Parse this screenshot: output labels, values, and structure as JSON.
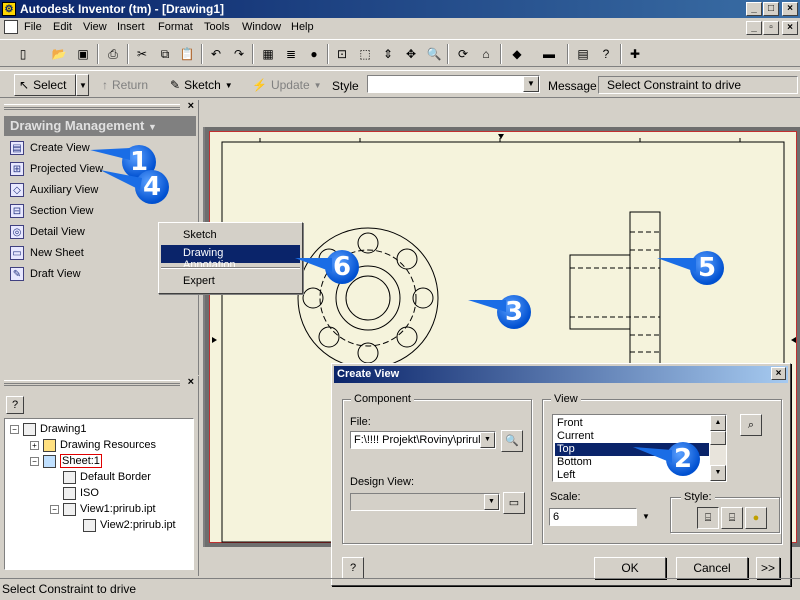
{
  "window": {
    "title": "Autodesk Inventor (tm) - [Drawing1]",
    "min": "_",
    "max": "□",
    "close": "×",
    "doc_min": "_",
    "doc_max": "▫",
    "doc_close": "×"
  },
  "menu": [
    "File",
    "Edit",
    "View",
    "Insert",
    "Format",
    "Tools",
    "Window",
    "Help"
  ],
  "toolbar2": {
    "select": "Select",
    "return": "Return",
    "sketch": "Sketch",
    "update": "Update",
    "style_label": "Style",
    "style_value": "",
    "message_label": "Message",
    "message_value": "Select Constraint to drive"
  },
  "panel": {
    "header": "Drawing Management",
    "close": "×",
    "items": [
      "Create View",
      "Projected View",
      "Auxiliary View",
      "Section View",
      "Detail View",
      "New Sheet",
      "Draft View"
    ]
  },
  "context_menu": [
    "Sketch",
    "Drawing Annotation",
    "Expert"
  ],
  "browser": {
    "close": "×",
    "help": "?",
    "items": [
      "Drawing1",
      "Drawing Resources",
      "Sheet:1",
      "Default Border",
      "ISO",
      "View1:prirub.ipt",
      "View2:prirub.ipt"
    ]
  },
  "callouts": [
    "1",
    "2",
    "3",
    "4",
    "5",
    "6"
  ],
  "dialog": {
    "title": "Create View",
    "close": "×",
    "component_group": "Component",
    "file_label": "File:",
    "file_value": "F:\\!!!! Projekt\\Roviny\\prirul",
    "design_view_label": "Design View:",
    "design_view_value": "",
    "view_group": "View",
    "view_options": [
      "Front",
      "Current",
      "Top",
      "Bottom",
      "Left"
    ],
    "selected_view": "Top",
    "scale_label": "Scale:",
    "scale_value": "6",
    "style_label": "Style:",
    "help": "?",
    "ok": "OK",
    "cancel": "Cancel",
    "more": ">>"
  },
  "status": "Select Constraint to drive",
  "colors": {
    "titlebar": "#0a246a",
    "callout": "#1a6de6",
    "sheet": "#f5f3dc",
    "selection": "#0a246a"
  }
}
